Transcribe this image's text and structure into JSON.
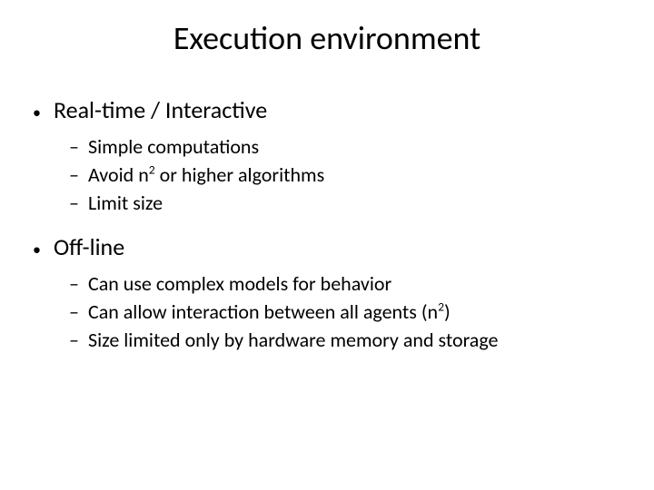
{
  "title": "Execution environment",
  "section1": {
    "heading": "Real-time / Interactive",
    "items": [
      "Simple computations",
      "Avoid n",
      " or higher algorithms",
      "Limit size"
    ],
    "sup": "2"
  },
  "section2": {
    "heading": "Off-line",
    "items": [
      "Can use complex models for behavior",
      "Can allow interaction between all agents (n",
      ")",
      "Size limited only by hardware memory and storage"
    ],
    "sup": "2"
  }
}
